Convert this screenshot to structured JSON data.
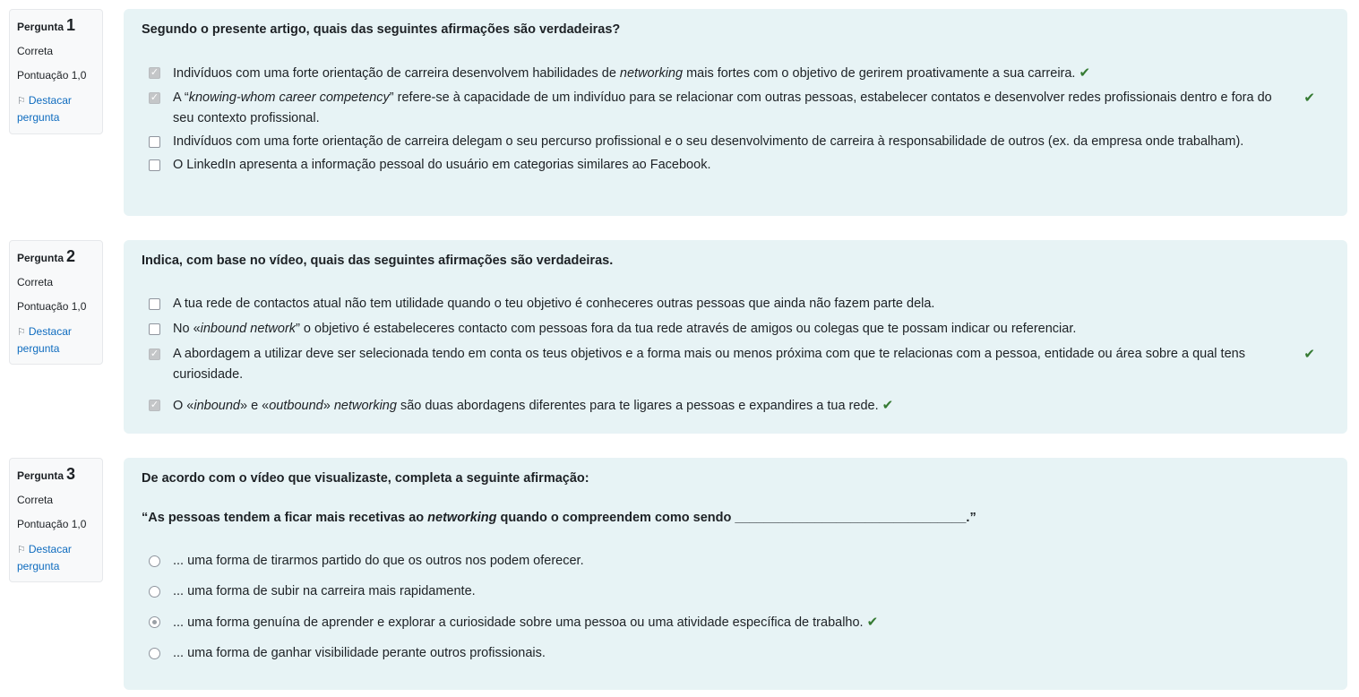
{
  "questions": [
    {
      "label": "Pergunta",
      "number": "1",
      "state": "Correta",
      "grade": "Pontuação 1,0",
      "flag": "Destacar pergunta",
      "text": "Segundo o presente artigo, quais das seguintes afirmações são verdadeiras?",
      "answers": [
        {
          "p1": "Indivíduos com uma forte orientação de carreira desenvolvem habilidades de ",
          "i1": "networking",
          "p2": " mais fortes com o objetivo de gerirem proativamente a sua carreira.",
          "checked": true,
          "correct": true
        },
        {
          "p1": "A “",
          "i1": "knowing-whom career competency",
          "p2": "” refere-se à capacidade de um indivíduo para se relacionar com outras pessoas, estabelecer contatos e desenvolver redes profissionais dentro e fora do seu contexto profissional.",
          "checked": true,
          "correct": true
        },
        {
          "p1": "Indivíduos com uma forte orientação de carreira delegam o seu percurso profissional e o seu desenvolvimento de carreira à responsabilidade de outros (ex. da empresa onde trabalham).",
          "checked": false
        },
        {
          "p1": "O LinkedIn apresenta a informação pessoal do usuário em categorias similares ao Facebook.",
          "checked": false
        }
      ]
    },
    {
      "label": "Pergunta",
      "number": "2",
      "state": "Correta",
      "grade": "Pontuação 1,0",
      "flag": "Destacar pergunta",
      "text": "Indica, com base no vídeo, quais das seguintes afirmações são verdadeiras.",
      "answers": [
        {
          "p1": "A tua rede de contactos atual não tem utilidade quando o teu objetivo é conheceres outras pessoas que ainda não fazem parte dela.",
          "checked": false
        },
        {
          "p1": "No «",
          "i1": "inbound network",
          "p2": "” o objetivo é estabeleceres contacto com pessoas fora da tua rede através de amigos ou colegas que te possam indicar ou referenciar.",
          "checked": false
        },
        {
          "p1": "A abordagem a utilizar deve ser selecionada tendo em conta os teus objetivos e a forma mais ou menos próxima com que te relacionas com a pessoa, entidade ou área sobre a qual tens curiosidade.",
          "checked": true,
          "correct": true
        },
        {
          "p1": "O «",
          "i1": "inbound",
          "p2": "» e «",
          "i2": "outbound",
          "p3": "» ",
          "i3": "networking",
          "p4": " são duas abordagens diferentes para te ligares a pessoas e expandires a tua rede.",
          "checked": true,
          "correct": true
        }
      ]
    },
    {
      "label": "Pergunta",
      "number": "3",
      "state": "Correta",
      "grade": "Pontuação 1,0",
      "flag": "Destacar pergunta",
      "text": "De acordo com o vídeo que visualizaste, completa a seguinte afirmação:",
      "text2": {
        "p1": "“As pessoas tendem a ficar mais recetivas ao ",
        "i1": "networking",
        "p2": " quando o compreendem como sendo ________________________________.”"
      },
      "answers": [
        {
          "p1": "... uma forma de tirarmos partido do que os outros nos podem oferecer.",
          "checked": false
        },
        {
          "p1": "... uma forma de subir na carreira mais rapidamente.",
          "checked": false
        },
        {
          "p1": "... uma forma genuína de aprender e explorar a curiosidade sobre uma pessoa ou uma atividade específica de trabalho.",
          "checked": true,
          "correct": true
        },
        {
          "p1": "... uma forma de ganhar visibilidade perante outros profissionais.",
          "checked": false
        }
      ]
    }
  ],
  "icons": {
    "flag": "flag-icon",
    "tick": "check-icon"
  },
  "colors": {
    "panel": "#e7f3f5",
    "link": "#0f6cbf",
    "correct": "#357a32"
  }
}
